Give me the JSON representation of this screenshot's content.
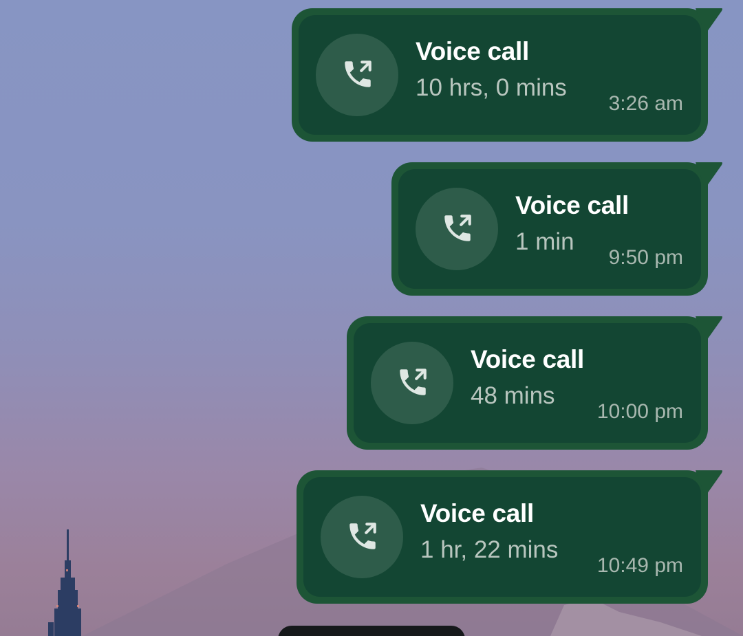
{
  "chat": {
    "messages": [
      {
        "title": "Voice call",
        "duration": "10 hrs, 0 mins",
        "time": "3:26 am",
        "icon": "outgoing-call-icon"
      },
      {
        "title": "Voice call",
        "duration": "1 min",
        "time": "9:50 pm",
        "icon": "outgoing-call-icon"
      },
      {
        "title": "Voice call",
        "duration": "48 mins",
        "time": "10:00 pm",
        "icon": "outgoing-call-icon"
      },
      {
        "title": "Voice call",
        "duration": "1 hr, 22 mins",
        "time": "10:49 pm",
        "icon": "outgoing-call-icon"
      }
    ]
  },
  "colors": {
    "bubble_border": "#1d5536",
    "bubble_fill": "#134633",
    "icon_circle": "#2e5c4a",
    "title_text": "#ffffff",
    "secondary_text": "#b9c6bf"
  }
}
